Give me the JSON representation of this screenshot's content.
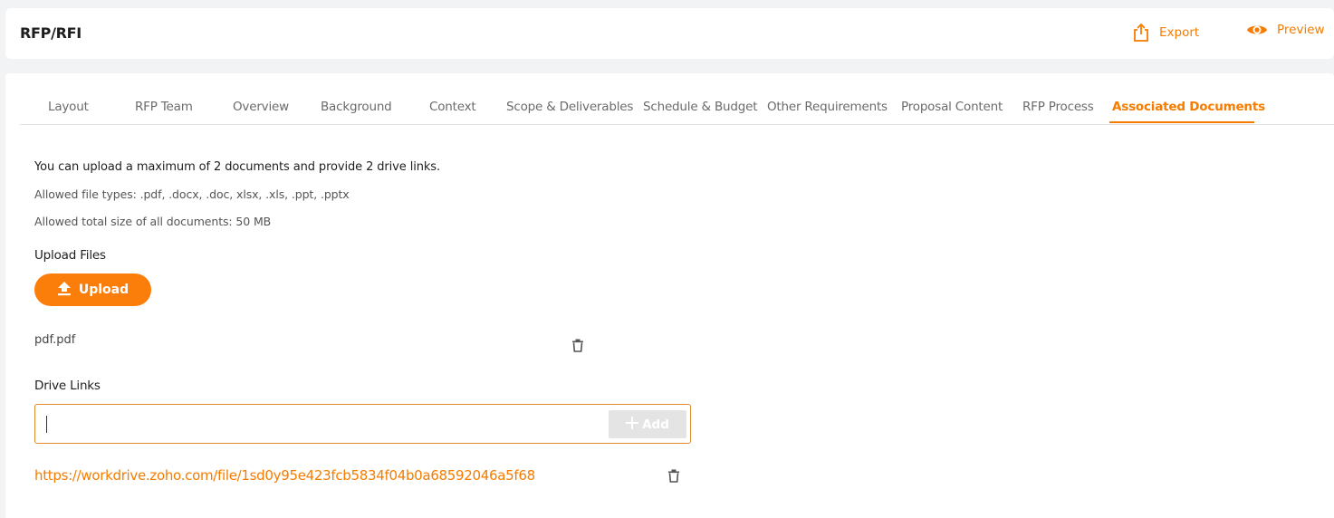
{
  "header": {
    "title": "RFP/RFI",
    "export_label": "Export",
    "preview_label": "Preview"
  },
  "tabs": [
    {
      "label": "Layout",
      "active": false
    },
    {
      "label": "RFP Team",
      "active": false
    },
    {
      "label": "Overview",
      "active": false
    },
    {
      "label": "Background",
      "active": false
    },
    {
      "label": "Context",
      "active": false
    },
    {
      "label": "Scope & Deliverables",
      "active": false
    },
    {
      "label": "Schedule & Budget",
      "active": false
    },
    {
      "label": "Other Requirements",
      "active": false
    },
    {
      "label": "Proposal Content",
      "active": false
    },
    {
      "label": "RFP Process",
      "active": false
    },
    {
      "label": "Associated Documents",
      "active": true
    }
  ],
  "info": {
    "limits": "You can upload a maximum of 2 documents and provide 2 drive links.",
    "file_types": "Allowed file types: .pdf, .docx, .doc, xlsx, .xls, .ppt, .pptx",
    "total_size": "Allowed total size of all documents: 50 MB"
  },
  "upload": {
    "section_label": "Upload Files",
    "button_label": "Upload",
    "files": [
      {
        "name": "pdf.pdf"
      }
    ]
  },
  "drive": {
    "section_label": "Drive Links",
    "input_value": "",
    "add_label": "Add",
    "links": [
      {
        "url": "https://workdrive.zoho.com/file/1sd0y95e423fcb5834f04b0a68592046a5f68"
      }
    ]
  },
  "colors": {
    "accent": "#f57c00",
    "upload_button": "#fb7d0a",
    "add_button_disabled": "#e4e4e4"
  }
}
